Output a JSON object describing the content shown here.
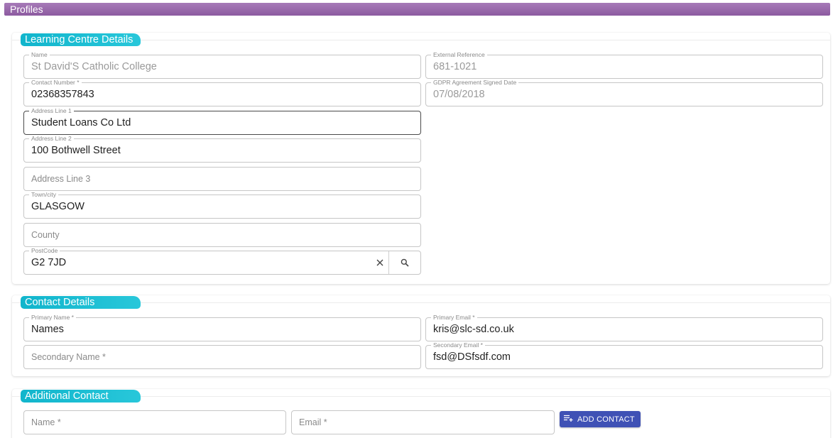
{
  "header": {
    "title": "Profiles"
  },
  "colors": {
    "header": "#9b6aaf",
    "section_tag": "#1ab8cf",
    "button": "#3f51b5"
  },
  "learning_centre": {
    "heading": "Learning Centre Details",
    "name": {
      "label": "Name",
      "value": "St David'S Catholic College"
    },
    "contact_number": {
      "label": "Contact Number *",
      "value": "02368357843"
    },
    "address_line_1": {
      "label": "Address Line 1",
      "value": "Student Loans Co Ltd"
    },
    "address_line_2": {
      "label": "Address Line 2",
      "value": "100 Bothwell Street"
    },
    "address_line_3": {
      "placeholder": "Address Line 3"
    },
    "town_city": {
      "label": "Town/city",
      "value": "GLASGOW"
    },
    "county": {
      "placeholder": "County"
    },
    "postcode": {
      "label": "PostCode",
      "value": "G2 7JD",
      "clear_icon": "close-icon",
      "search_icon": "search-icon"
    },
    "external_reference": {
      "label": "External Reference",
      "value": "681-1021"
    },
    "gdpr_date": {
      "label": "GDPR Agreement Signed Date",
      "value": "07/08/2018"
    }
  },
  "contact_details": {
    "heading": "Contact Details",
    "primary_name": {
      "label": "Primary Name *",
      "value": "Names"
    },
    "primary_email": {
      "label": "Primary Email *",
      "value": "kris@slc-sd.co.uk"
    },
    "secondary_name": {
      "placeholder": "Secondary Name *"
    },
    "secondary_email": {
      "label": "Secondary Email *",
      "value": "fsd@DSfsdf.com"
    }
  },
  "additional_contact": {
    "heading": "Additional Contact",
    "name": {
      "placeholder": "Name *"
    },
    "email": {
      "placeholder": "Email *"
    },
    "add_button": {
      "label": "ADD CONTACT",
      "icon": "playlist-add-icon"
    }
  }
}
